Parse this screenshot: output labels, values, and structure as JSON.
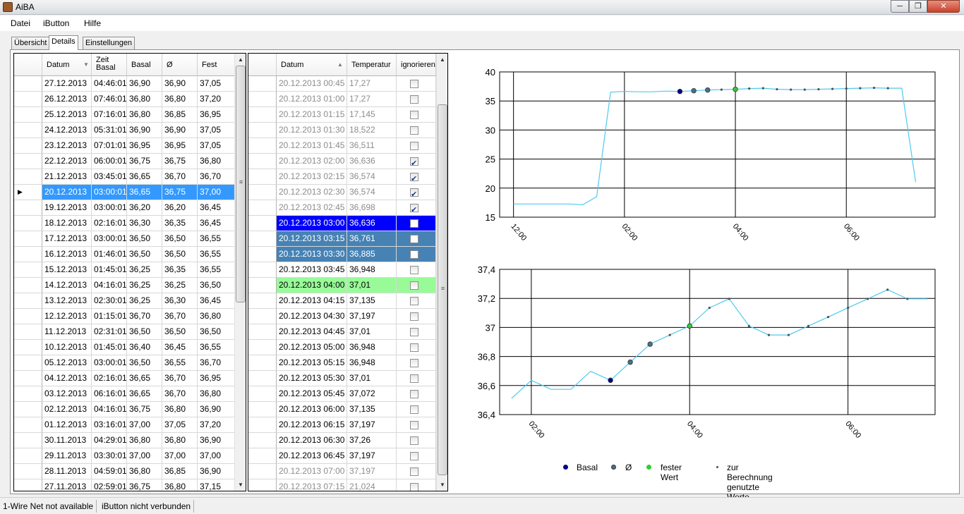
{
  "window": {
    "title": "AiBA",
    "min_glyph": "─",
    "max_glyph": "❐",
    "close_glyph": "✕"
  },
  "menu": [
    "Datei",
    "iButton",
    "Hilfe"
  ],
  "tabs": [
    {
      "label": "Übersicht",
      "active": false
    },
    {
      "label": "Details",
      "active": true
    },
    {
      "label": "Einstellungen",
      "active": false
    }
  ],
  "days_grid": {
    "headers": [
      "Datum",
      "Zeit Basal",
      "Basal",
      "Ø",
      "Fest"
    ],
    "selected_index": 7,
    "rows": [
      [
        "27.12.2013",
        "04:46:01",
        "36,90",
        "36,90",
        "37,05"
      ],
      [
        "26.12.2013",
        "07:46:01",
        "36,80",
        "36,80",
        "37,20"
      ],
      [
        "25.12.2013",
        "07:16:01",
        "36,80",
        "36,85",
        "36,95"
      ],
      [
        "24.12.2013",
        "05:31:01",
        "36,90",
        "36,90",
        "37,05"
      ],
      [
        "23.12.2013",
        "07:01:01",
        "36,95",
        "36,95",
        "37,05"
      ],
      [
        "22.12.2013",
        "06:00:01",
        "36,75",
        "36,75",
        "36,80"
      ],
      [
        "21.12.2013",
        "03:45:01",
        "36,65",
        "36,70",
        "36,70"
      ],
      [
        "20.12.2013",
        "03:00:01",
        "36,65",
        "36,75",
        "37,00"
      ],
      [
        "19.12.2013",
        "03:00:01",
        "36,20",
        "36,20",
        "36,45"
      ],
      [
        "18.12.2013",
        "02:16:01",
        "36,30",
        "36,35",
        "36,45"
      ],
      [
        "17.12.2013",
        "03:00:01",
        "36,50",
        "36,50",
        "36,55"
      ],
      [
        "16.12.2013",
        "01:46:01",
        "36,50",
        "36,50",
        "36,55"
      ],
      [
        "15.12.2013",
        "01:45:01",
        "36,25",
        "36,35",
        "36,55"
      ],
      [
        "14.12.2013",
        "04:16:01",
        "36,25",
        "36,25",
        "36,50"
      ],
      [
        "13.12.2013",
        "02:30:01",
        "36,25",
        "36,30",
        "36,45"
      ],
      [
        "12.12.2013",
        "01:15:01",
        "36,70",
        "36,70",
        "36,80"
      ],
      [
        "11.12.2013",
        "02:31:01",
        "36,50",
        "36,50",
        "36,50"
      ],
      [
        "10.12.2013",
        "01:45:01",
        "36,40",
        "36,45",
        "36,55"
      ],
      [
        "05.12.2013",
        "03:00:01",
        "36,50",
        "36,55",
        "36,70"
      ],
      [
        "04.12.2013",
        "02:16:01",
        "36,65",
        "36,70",
        "36,95"
      ],
      [
        "03.12.2013",
        "06:16:01",
        "36,65",
        "36,70",
        "36,80"
      ],
      [
        "02.12.2013",
        "04:16:01",
        "36,75",
        "36,80",
        "36,90"
      ],
      [
        "01.12.2013",
        "03:16:01",
        "37,00",
        "37,05",
        "37,20"
      ],
      [
        "30.11.2013",
        "04:29:01",
        "36,80",
        "36,80",
        "36,90"
      ],
      [
        "29.11.2013",
        "03:30:01",
        "37,00",
        "37,00",
        "37,00"
      ],
      [
        "28.11.2013",
        "04:59:01",
        "36,80",
        "36,85",
        "36,90"
      ],
      [
        "27.11.2013",
        "02:59:01",
        "36,75",
        "36,80",
        "37,15"
      ]
    ]
  },
  "readings_grid": {
    "headers": [
      "Datum",
      "Temperatur",
      "ignorieren"
    ],
    "rows": [
      {
        "datum": "20.12.2013 00:45",
        "temp": "17,27",
        "ign": false,
        "style": "gray"
      },
      {
        "datum": "20.12.2013 01:00",
        "temp": "17,27",
        "ign": false,
        "style": "gray"
      },
      {
        "datum": "20.12.2013 01:15",
        "temp": "17,145",
        "ign": false,
        "style": "gray"
      },
      {
        "datum": "20.12.2013 01:30",
        "temp": "18,522",
        "ign": false,
        "style": "gray"
      },
      {
        "datum": "20.12.2013 01:45",
        "temp": "36,511",
        "ign": false,
        "style": "gray"
      },
      {
        "datum": "20.12.2013 02:00",
        "temp": "36,636",
        "ign": true,
        "style": "gray"
      },
      {
        "datum": "20.12.2013 02:15",
        "temp": "36,574",
        "ign": true,
        "style": "gray"
      },
      {
        "datum": "20.12.2013 02:30",
        "temp": "36,574",
        "ign": true,
        "style": "gray"
      },
      {
        "datum": "20.12.2013 02:45",
        "temp": "36,698",
        "ign": true,
        "style": "gray"
      },
      {
        "datum": "20.12.2013 03:00",
        "temp": "36,636",
        "ign": false,
        "style": "basal"
      },
      {
        "datum": "20.12.2013 03:15",
        "temp": "36,761",
        "ign": false,
        "style": "avg"
      },
      {
        "datum": "20.12.2013 03:30",
        "temp": "36,885",
        "ign": false,
        "style": "avg"
      },
      {
        "datum": "20.12.2013 03:45",
        "temp": "36,948",
        "ign": false,
        "style": "normal"
      },
      {
        "datum": "20.12.2013 04:00",
        "temp": "37,01",
        "ign": false,
        "style": "fixed"
      },
      {
        "datum": "20.12.2013 04:15",
        "temp": "37,135",
        "ign": false,
        "style": "normal"
      },
      {
        "datum": "20.12.2013 04:30",
        "temp": "37,197",
        "ign": false,
        "style": "normal"
      },
      {
        "datum": "20.12.2013 04:45",
        "temp": "37,01",
        "ign": false,
        "style": "normal"
      },
      {
        "datum": "20.12.2013 05:00",
        "temp": "36,948",
        "ign": false,
        "style": "normal"
      },
      {
        "datum": "20.12.2013 05:15",
        "temp": "36,948",
        "ign": false,
        "style": "normal"
      },
      {
        "datum": "20.12.2013 05:30",
        "temp": "37,01",
        "ign": false,
        "style": "normal"
      },
      {
        "datum": "20.12.2013 05:45",
        "temp": "37,072",
        "ign": false,
        "style": "normal"
      },
      {
        "datum": "20.12.2013 06:00",
        "temp": "37,135",
        "ign": false,
        "style": "normal"
      },
      {
        "datum": "20.12.2013 06:15",
        "temp": "37,197",
        "ign": false,
        "style": "normal"
      },
      {
        "datum": "20.12.2013 06:30",
        "temp": "37,26",
        "ign": false,
        "style": "normal"
      },
      {
        "datum": "20.12.2013 06:45",
        "temp": "37,197",
        "ign": false,
        "style": "normal"
      },
      {
        "datum": "20.12.2013 07:00",
        "temp": "37,197",
        "ign": false,
        "style": "gray"
      },
      {
        "datum": "20.12.2013 07:15",
        "temp": "21,024",
        "ign": false,
        "style": "gray"
      }
    ]
  },
  "colors": {
    "selection": "#3399ff",
    "basal_row": "#0000ff",
    "avg_row": "#4682b4",
    "fixed_row": "#98fb98",
    "line": "#4ec9f0",
    "basal_dot": "#00008b",
    "avg_dot": "#4a708b",
    "fixed_dot": "#32cd32",
    "calc_dot": "#505050"
  },
  "chart_data": [
    {
      "type": "line",
      "title": "",
      "xlabel": "",
      "ylabel": "",
      "x_unit": "hours since 20.12.2013 00:00",
      "xlim": [
        -0.25,
        7.6
      ],
      "ylim": [
        15,
        40
      ],
      "yticks": [
        15,
        20,
        25,
        30,
        35,
        40
      ],
      "xticks": [
        {
          "x": 0,
          "label": "12:00"
        },
        {
          "x": 2,
          "label": "02:00"
        },
        {
          "x": 4,
          "label": "04:00"
        },
        {
          "x": 6,
          "label": "06:00"
        }
      ],
      "grid": true,
      "series": [
        {
          "x": [
            0,
            0.25,
            0.5,
            0.75,
            1.0,
            1.25,
            1.5,
            1.75,
            2.0,
            2.25,
            2.5,
            2.75,
            3.0,
            3.25,
            3.5,
            3.75,
            4.0,
            4.25,
            4.5,
            4.75,
            5.0,
            5.25,
            5.5,
            5.75,
            6.0,
            6.25,
            6.5,
            6.75,
            7.0,
            7.25
          ],
          "y": [
            17.27,
            17.27,
            17.27,
            17.27,
            17.27,
            17.145,
            18.522,
            36.511,
            36.636,
            36.574,
            36.574,
            36.698,
            36.636,
            36.761,
            36.885,
            36.948,
            37.01,
            37.135,
            37.197,
            37.01,
            36.948,
            36.948,
            37.01,
            37.072,
            37.135,
            37.197,
            37.26,
            37.197,
            37.197,
            21.024
          ]
        }
      ],
      "markers": [
        {
          "kind": "basal",
          "x": 3.0,
          "y": 36.636
        },
        {
          "kind": "avg",
          "x": 3.25,
          "y": 36.761
        },
        {
          "kind": "avg",
          "x": 3.5,
          "y": 36.885
        },
        {
          "kind": "fixed",
          "x": 4.0,
          "y": 37.01
        },
        {
          "kind": "calc",
          "xs": [
            3.75,
            4.25,
            4.5,
            4.75,
            5.0,
            5.25,
            5.5,
            5.75,
            6.0,
            6.25,
            6.5,
            6.75
          ]
        }
      ]
    },
    {
      "type": "line",
      "title": "",
      "xlabel": "",
      "ylabel": "",
      "x_unit": "hours since 20.12.2013 00:00",
      "xlim": [
        1.6,
        7.1
      ],
      "ylim": [
        36.4,
        37.4
      ],
      "yticks": [
        36.4,
        36.6,
        36.8,
        37.0,
        37.2,
        37.4
      ],
      "ytick_labels": [
        "36,4",
        "36,6",
        "36,8",
        "37",
        "37,2",
        "37,4"
      ],
      "xticks": [
        {
          "x": 2,
          "label": "02:00"
        },
        {
          "x": 4,
          "label": "04:00"
        },
        {
          "x": 6,
          "label": "06:00"
        }
      ],
      "grid": true,
      "series": [
        {
          "x": [
            1.75,
            2.0,
            2.25,
            2.5,
            2.75,
            3.0,
            3.25,
            3.5,
            3.75,
            4.0,
            4.25,
            4.5,
            4.75,
            5.0,
            5.25,
            5.5,
            5.75,
            6.0,
            6.25,
            6.5,
            6.75,
            7.0
          ],
          "y": [
            36.511,
            36.636,
            36.574,
            36.574,
            36.698,
            36.636,
            36.761,
            36.885,
            36.948,
            37.01,
            37.135,
            37.197,
            37.01,
            36.948,
            36.948,
            37.01,
            37.072,
            37.135,
            37.197,
            37.26,
            37.197,
            37.197
          ]
        }
      ],
      "markers": [
        {
          "kind": "basal",
          "x": 3.0,
          "y": 36.636
        },
        {
          "kind": "avg",
          "x": 3.25,
          "y": 36.761
        },
        {
          "kind": "avg",
          "x": 3.5,
          "y": 36.885
        },
        {
          "kind": "fixed",
          "x": 4.0,
          "y": 37.01
        },
        {
          "kind": "calc",
          "xs": [
            3.75,
            4.25,
            4.5,
            4.75,
            5.0,
            5.25,
            5.5,
            5.75,
            6.0,
            6.25,
            6.5,
            6.75
          ]
        }
      ]
    }
  ],
  "legend": [
    {
      "label": "Basal",
      "kind": "basal"
    },
    {
      "label": "Ø",
      "kind": "avg"
    },
    {
      "label": "fester Wert",
      "kind": "fixed"
    },
    {
      "label": "zur Berechnung genutzte Werte",
      "kind": "calc"
    }
  ],
  "status": [
    "1-Wire Net not available",
    "iButton nicht verbunden"
  ]
}
